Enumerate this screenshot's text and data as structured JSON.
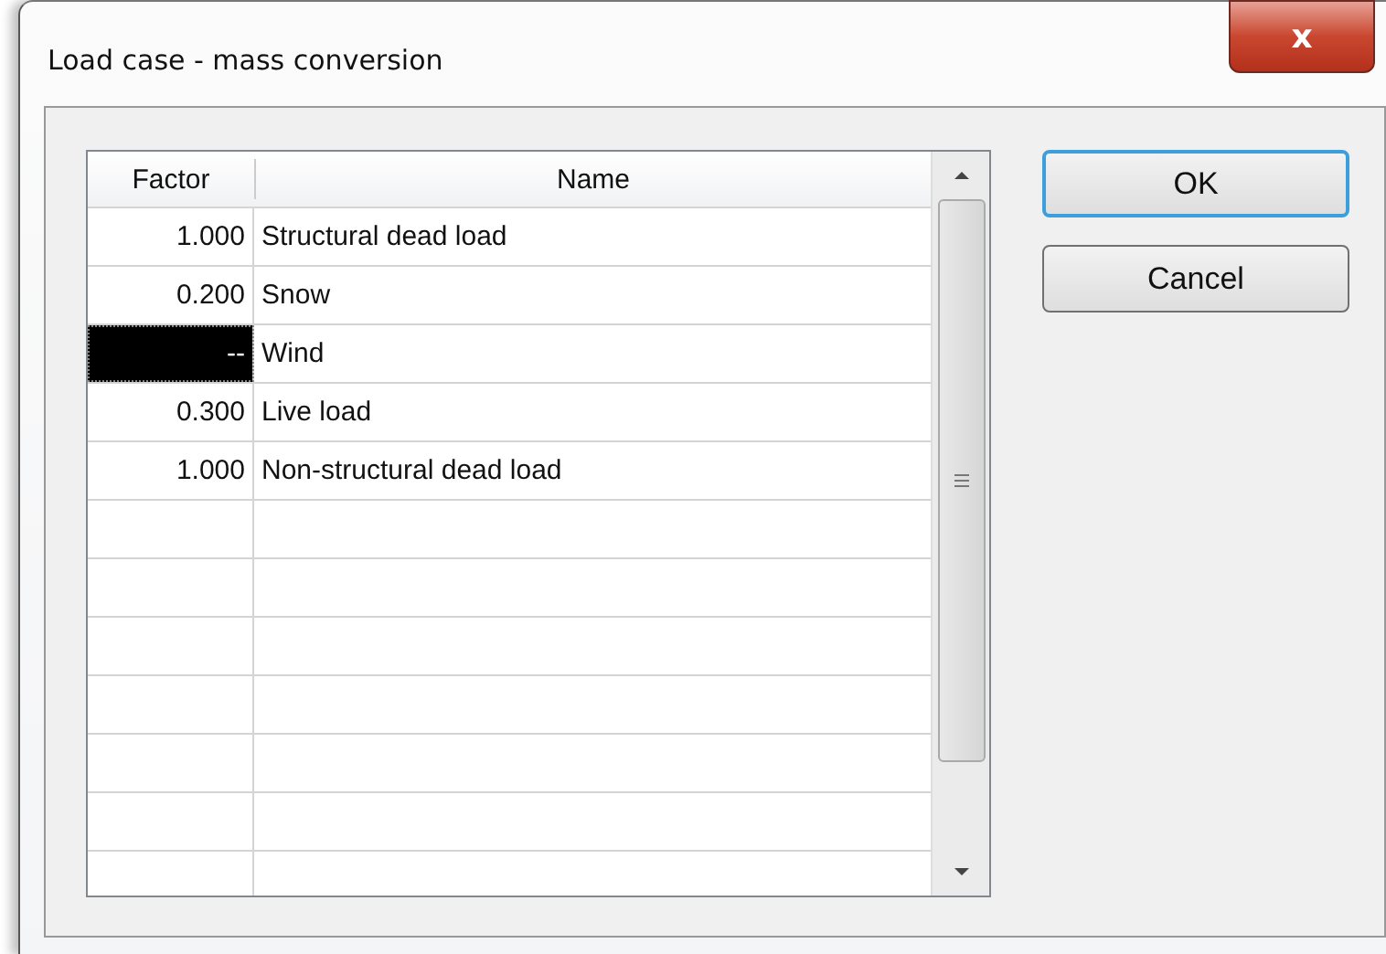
{
  "window": {
    "title": "Load case - mass conversion",
    "close": "x"
  },
  "table": {
    "columns": [
      "Factor",
      "Name"
    ],
    "rows": [
      {
        "factor": "1.000",
        "name": "Structural dead load",
        "selected": false
      },
      {
        "factor": "0.200",
        "name": "Snow",
        "selected": false
      },
      {
        "factor": "--",
        "name": "Wind",
        "selected": true
      },
      {
        "factor": "0.300",
        "name": "Live load",
        "selected": false
      },
      {
        "factor": "1.000",
        "name": "Non-structural dead load",
        "selected": false
      }
    ]
  },
  "buttons": [
    {
      "label": "OK",
      "kind": "default"
    },
    {
      "label": "Cancel",
      "kind": "normal"
    }
  ]
}
